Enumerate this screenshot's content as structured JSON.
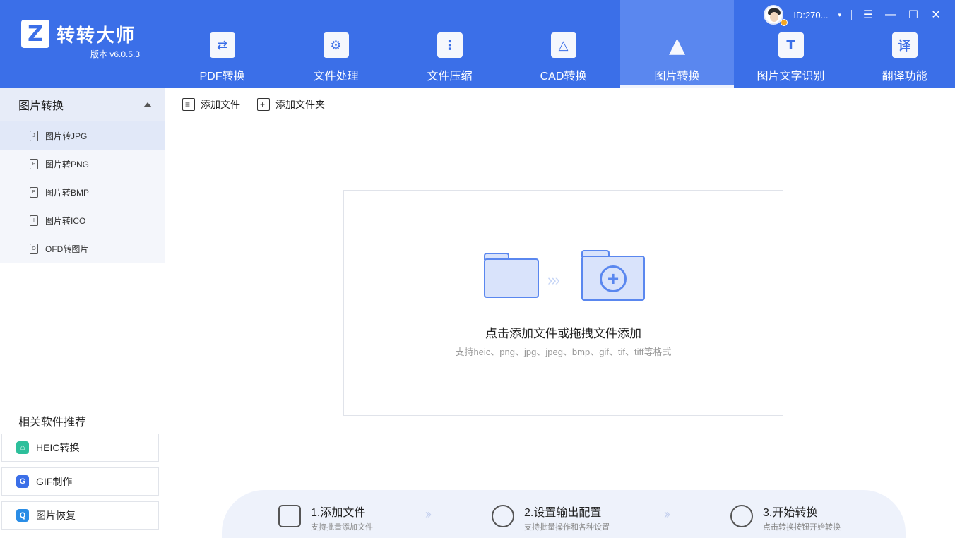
{
  "app": {
    "name": "转转大师",
    "version": "版本 v6.0.5.3",
    "logo_letter": "Z"
  },
  "topbar": {
    "user_id": "ID:270...",
    "caret": "▾",
    "menu_glyph": "☰",
    "min_glyph": "—",
    "max_glyph": "☐",
    "close_glyph": "✕"
  },
  "nav": {
    "tabs": [
      {
        "label": "PDF转换",
        "glyph": "⇄",
        "icon": "pdf-convert-icon"
      },
      {
        "label": "文件处理",
        "glyph": "⚙",
        "icon": "file-process-icon"
      },
      {
        "label": "文件压缩",
        "glyph": "⋮",
        "icon": "zip-icon"
      },
      {
        "label": "CAD转换",
        "glyph": "△",
        "icon": "cad-icon"
      },
      {
        "label": "图片转换",
        "glyph": "▲",
        "icon": "image-convert-icon"
      },
      {
        "label": "图片文字识别",
        "glyph": "T",
        "icon": "ocr-icon"
      },
      {
        "label": "翻译功能",
        "glyph": "译",
        "icon": "translate-icon"
      }
    ],
    "active": "图片转换"
  },
  "sidebar": {
    "title": "图片转换",
    "items": [
      {
        "label": "图片转JPG",
        "badge": "J"
      },
      {
        "label": "图片转PNG",
        "badge": "P"
      },
      {
        "label": "图片转BMP",
        "badge": "B"
      },
      {
        "label": "图片转ICO",
        "badge": "I"
      },
      {
        "label": "OFD转图片",
        "badge": "O"
      }
    ],
    "recommend_title": "相关软件推荐",
    "recommend": [
      {
        "label": "HEIC转换",
        "color": "#2dbf9b",
        "glyph": "⌂"
      },
      {
        "label": "GIF制作",
        "color": "#3b6fe8",
        "glyph": "G"
      },
      {
        "label": "图片恢复",
        "color": "#2a8de6",
        "glyph": "Q"
      }
    ]
  },
  "toolbar": {
    "add_file": "添加文件",
    "add_folder": "添加文件夹"
  },
  "dropzone": {
    "main_text": "点击添加文件或拖拽文件添加",
    "sub_text": "支持heic、png、jpg、jpeg、bmp、gif、tif、tiff等格式",
    "arrows": "›››",
    "plus": "+"
  },
  "steps": [
    {
      "title": "1.添加文件",
      "desc": "支持批量添加文件"
    },
    {
      "title": "2.设置输出配置",
      "desc": "支持批量操作和各种设置"
    },
    {
      "title": "3.开始转换",
      "desc": "点击转换按钮开始转换"
    }
  ],
  "step_arrow": "››",
  "colors": {
    "brand": "#3b6fe8",
    "active_tab": "#5a87ef",
    "folder_fill": "#d9e3fb"
  }
}
